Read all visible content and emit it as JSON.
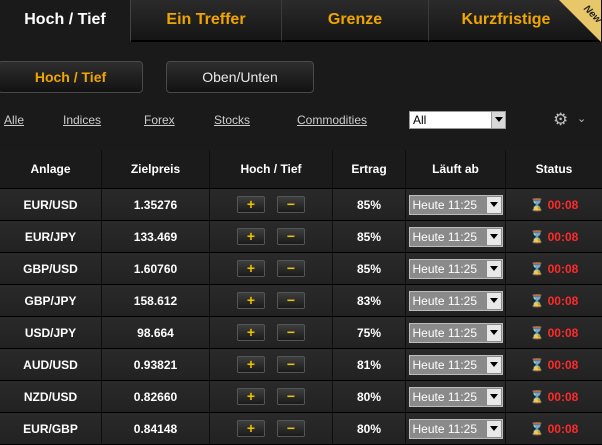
{
  "tabs": [
    {
      "label": "Hoch / Tief",
      "active": true
    },
    {
      "label": "Ein Treffer",
      "active": false
    },
    {
      "label": "Grenze",
      "active": false
    },
    {
      "label": "Kurzfristige",
      "active": false,
      "badge": "New"
    }
  ],
  "subnav": {
    "hoch_tief": "Hoch / Tief",
    "oben_unten": "Oben/Unten"
  },
  "filters": {
    "links": [
      "Alle",
      "Indices",
      "Forex",
      "Stocks",
      "Commodities"
    ],
    "select_value": "All"
  },
  "table": {
    "headers": [
      "Anlage",
      "Zielpreis",
      "Hoch / Tief",
      "Ertrag",
      "Läuft ab",
      "Status"
    ],
    "plus": "+",
    "minus": "−",
    "rows": [
      {
        "asset": "EUR/USD",
        "target": "1.35276",
        "yield": "85%",
        "expiry": "Heute 11:25",
        "status": "00:08"
      },
      {
        "asset": "EUR/JPY",
        "target": "133.469",
        "yield": "85%",
        "expiry": "Heute 11:25",
        "status": "00:08"
      },
      {
        "asset": "GBP/USD",
        "target": "1.60760",
        "yield": "85%",
        "expiry": "Heute 11:25",
        "status": "00:08"
      },
      {
        "asset": "GBP/JPY",
        "target": "158.612",
        "yield": "83%",
        "expiry": "Heute 11:25",
        "status": "00:08"
      },
      {
        "asset": "USD/JPY",
        "target": "98.664",
        "yield": "75%",
        "expiry": "Heute 11:25",
        "status": "00:08"
      },
      {
        "asset": "AUD/USD",
        "target": "0.93821",
        "yield": "81%",
        "expiry": "Heute 11:25",
        "status": "00:08"
      },
      {
        "asset": "NZD/USD",
        "target": "0.82660",
        "yield": "80%",
        "expiry": "Heute 11:25",
        "status": "00:08"
      },
      {
        "asset": "EUR/GBP",
        "target": "0.84148",
        "yield": "80%",
        "expiry": "Heute 11:25",
        "status": "00:08"
      }
    ]
  },
  "colors": {
    "accent": "#f0a500",
    "status_red": "#ff2a2a"
  },
  "icons": {
    "settings": "gear-icon",
    "status": "hourglass-icon"
  }
}
